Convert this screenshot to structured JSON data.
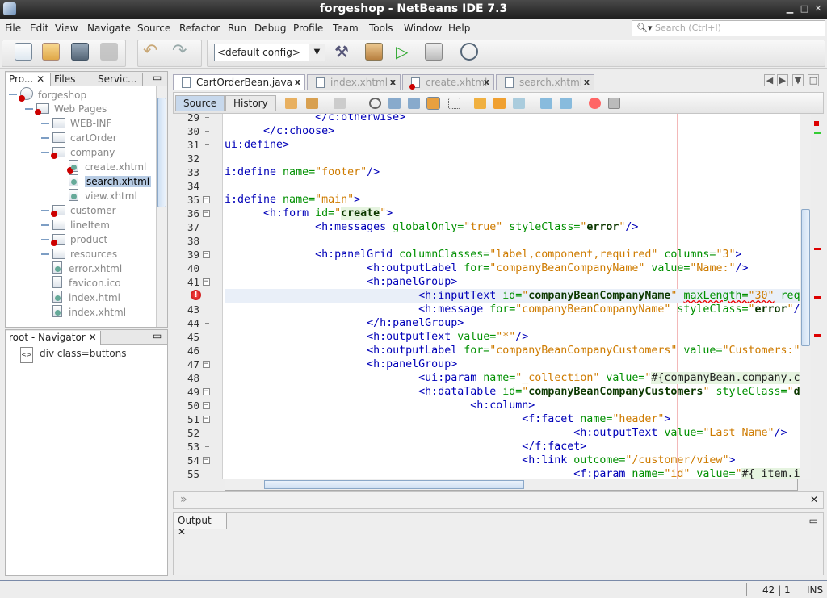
{
  "window": {
    "title": "forgeshop - NetBeans IDE 7.3"
  },
  "menu": [
    "File",
    "Edit",
    "View",
    "Navigate",
    "Source",
    "Refactor",
    "Run",
    "Debug",
    "Profile",
    "Team",
    "Tools",
    "Window",
    "Help"
  ],
  "search": {
    "placeholder": "Search (Ctrl+I)"
  },
  "toolbar": {
    "config": "<default config>",
    "icons": [
      "new-file",
      "new-project",
      "open-project",
      "save-all",
      "undo",
      "redo",
      "build",
      "clean-build",
      "run",
      "debug",
      "profile"
    ]
  },
  "left_panel": {
    "tabs": [
      "Pro...",
      "Files",
      "Servic..."
    ],
    "tree": [
      {
        "label": "forgeshop",
        "level": 0,
        "type": "project",
        "error": true
      },
      {
        "label": "Web Pages",
        "level": 1,
        "type": "folder",
        "error": true
      },
      {
        "label": "WEB-INF",
        "level": 2,
        "type": "folder"
      },
      {
        "label": "cartOrder",
        "level": 2,
        "type": "folder"
      },
      {
        "label": "company",
        "level": 2,
        "type": "folder",
        "error": true
      },
      {
        "label": "create.xhtml",
        "level": 3,
        "type": "file",
        "error": true
      },
      {
        "label": "search.xhtml",
        "level": 3,
        "type": "file",
        "selected": true
      },
      {
        "label": "view.xhtml",
        "level": 3,
        "type": "file"
      },
      {
        "label": "customer",
        "level": 2,
        "type": "folder",
        "error": true
      },
      {
        "label": "lineItem",
        "level": 2,
        "type": "folder"
      },
      {
        "label": "product",
        "level": 2,
        "type": "folder",
        "error": true
      },
      {
        "label": "resources",
        "level": 2,
        "type": "folder"
      },
      {
        "label": "error.xhtml",
        "level": 2,
        "type": "file"
      },
      {
        "label": "favicon.ico",
        "level": 2,
        "type": "plainfile"
      },
      {
        "label": "index.html",
        "level": 2,
        "type": "file"
      },
      {
        "label": "index.xhtml",
        "level": 2,
        "type": "file"
      }
    ]
  },
  "navigator": {
    "title": "root - Navigator",
    "items": [
      "div class=buttons"
    ]
  },
  "editor": {
    "tabs": [
      {
        "label": "CartOrderBean.java",
        "active": true
      },
      {
        "label": "index.xhtml"
      },
      {
        "label": "create.xhtml",
        "error": true
      },
      {
        "label": "search.xhtml"
      }
    ],
    "source_label": "Source",
    "history_label": "History",
    "lines": [
      {
        "n": "29",
        "fold": "end",
        "ind": 14,
        "tk": [
          [
            "</c:otherwise>",
            "tag"
          ]
        ]
      },
      {
        "n": "30",
        "fold": "end",
        "ind": 6,
        "tk": [
          [
            "</c:choose>",
            "tag"
          ]
        ]
      },
      {
        "n": "31",
        "fold": "end",
        "ind": 0,
        "tk": [
          [
            "ui:define>",
            "tag"
          ]
        ]
      },
      {
        "n": "32",
        "ind": 0,
        "tk": []
      },
      {
        "n": "33",
        "ind": 0,
        "tk": [
          [
            "i:define",
            "tag"
          ],
          [
            " name=",
            "attr"
          ],
          [
            "\"footer\"",
            "val"
          ],
          [
            "/>",
            "tag"
          ]
        ]
      },
      {
        "n": "34",
        "ind": 0,
        "tk": []
      },
      {
        "n": "35",
        "fold": "open",
        "ind": 0,
        "tk": [
          [
            "i:define",
            "tag"
          ],
          [
            " name=",
            "attr"
          ],
          [
            "\"main\"",
            "val"
          ],
          [
            ">",
            "tag"
          ]
        ]
      },
      {
        "n": "36",
        "fold": "open",
        "ind": 6,
        "tk": [
          [
            "<h:form",
            "tag"
          ],
          [
            " id=",
            "attr"
          ],
          [
            "\"",
            "val"
          ],
          [
            "create",
            "valb hl"
          ],
          [
            "\"",
            "val"
          ],
          [
            ">",
            "tag"
          ]
        ]
      },
      {
        "n": "37",
        "ind": 14,
        "tk": [
          [
            "<h:messages",
            "tag"
          ],
          [
            " globalOnly=",
            "attr"
          ],
          [
            "\"true\"",
            "val"
          ],
          [
            " styleClass=",
            "attr"
          ],
          [
            "\"",
            "val"
          ],
          [
            "error",
            "valb"
          ],
          [
            "\"",
            "val"
          ],
          [
            "/>",
            "tag"
          ]
        ]
      },
      {
        "n": "38",
        "ind": 0,
        "tk": []
      },
      {
        "n": "39",
        "fold": "open",
        "ind": 14,
        "tk": [
          [
            "<h:panelGrid",
            "tag"
          ],
          [
            " columnClasses=",
            "attr"
          ],
          [
            "\"label,component,required\"",
            "val"
          ],
          [
            " columns=",
            "attr"
          ],
          [
            "\"3\"",
            "val"
          ],
          [
            ">",
            "tag"
          ]
        ]
      },
      {
        "n": "40",
        "ind": 22,
        "tk": [
          [
            "<h:outputLabel",
            "tag"
          ],
          [
            " for=",
            "attr"
          ],
          [
            "\"companyBeanCompanyName\"",
            "val"
          ],
          [
            " value=",
            "attr"
          ],
          [
            "\"Name:\"",
            "val"
          ],
          [
            "/>",
            "tag"
          ]
        ]
      },
      {
        "n": "41",
        "fold": "open",
        "ind": 22,
        "tk": [
          [
            "<h:panelGroup>",
            "tag"
          ]
        ]
      },
      {
        "n": "",
        "error": true,
        "current": true,
        "ind": 30,
        "tk": [
          [
            "<h:inputText",
            "tag"
          ],
          [
            " id=",
            "attr"
          ],
          [
            "\"",
            "val"
          ],
          [
            "companyBeanCompanyName",
            "valb"
          ],
          [
            "\"",
            "val"
          ],
          [
            " ",
            "attr"
          ],
          [
            "maxLength=",
            "attr wavy"
          ],
          [
            "\"30\"",
            "val wavy"
          ],
          [
            " req",
            "attr"
          ]
        ]
      },
      {
        "n": "43",
        "ind": 30,
        "tk": [
          [
            "<h:message",
            "tag"
          ],
          [
            " for=",
            "attr"
          ],
          [
            "\"companyBeanCompanyName\"",
            "val"
          ],
          [
            " styleClass=",
            "attr"
          ],
          [
            "\"",
            "val"
          ],
          [
            "error",
            "valb"
          ],
          [
            "\"",
            "val"
          ],
          [
            "/",
            "tag"
          ]
        ]
      },
      {
        "n": "44",
        "fold": "end",
        "ind": 22,
        "tk": [
          [
            "</h:panelGroup>",
            "tag"
          ]
        ]
      },
      {
        "n": "45",
        "ind": 22,
        "tk": [
          [
            "<h:outputText",
            "tag"
          ],
          [
            " value=",
            "attr"
          ],
          [
            "\"*\"",
            "val"
          ],
          [
            "/>",
            "tag"
          ]
        ]
      },
      {
        "n": "46",
        "ind": 22,
        "tk": [
          [
            "<h:outputLabel",
            "tag"
          ],
          [
            " for=",
            "attr"
          ],
          [
            "\"companyBeanCompanyCustomers\"",
            "val"
          ],
          [
            " value=",
            "attr"
          ],
          [
            "\"Customers:\"",
            "val"
          ]
        ]
      },
      {
        "n": "47",
        "fold": "open",
        "ind": 22,
        "tk": [
          [
            "<h:panelGroup>",
            "tag"
          ]
        ]
      },
      {
        "n": "48",
        "ind": 30,
        "tk": [
          [
            "<ui:param",
            "tag"
          ],
          [
            " name=",
            "attr"
          ],
          [
            "\"_collection\"",
            "val"
          ],
          [
            " value=",
            "attr"
          ],
          [
            "\"",
            "val"
          ],
          [
            "#{companyBean.company.c",
            "hl"
          ]
        ]
      },
      {
        "n": "49",
        "fold": "open",
        "ind": 30,
        "tk": [
          [
            "<h:dataTable",
            "tag"
          ],
          [
            " id=",
            "attr"
          ],
          [
            "\"",
            "val"
          ],
          [
            "companyBeanCompanyCustomers",
            "valb"
          ],
          [
            "\"",
            "val"
          ],
          [
            " styleClass=",
            "attr"
          ],
          [
            "\"",
            "val"
          ],
          [
            "d",
            "valb"
          ]
        ]
      },
      {
        "n": "50",
        "fold": "open",
        "ind": 38,
        "tk": [
          [
            "<h:column>",
            "tag"
          ]
        ]
      },
      {
        "n": "51",
        "fold": "open",
        "ind": 46,
        "tk": [
          [
            "<f:facet",
            "tag"
          ],
          [
            " name=",
            "attr"
          ],
          [
            "\"header\"",
            "val"
          ],
          [
            ">",
            "tag"
          ]
        ]
      },
      {
        "n": "52",
        "ind": 54,
        "tk": [
          [
            "<h:outputText",
            "tag"
          ],
          [
            " value=",
            "attr"
          ],
          [
            "\"Last Name\"",
            "val"
          ],
          [
            "/>",
            "tag"
          ]
        ]
      },
      {
        "n": "53",
        "fold": "end",
        "ind": 46,
        "tk": [
          [
            "</f:facet>",
            "tag"
          ]
        ]
      },
      {
        "n": "54",
        "fold": "open",
        "ind": 46,
        "tk": [
          [
            "<h:link",
            "tag"
          ],
          [
            " outcome=",
            "attr"
          ],
          [
            "\"/customer/view\"",
            "val"
          ],
          [
            ">",
            "tag"
          ]
        ]
      },
      {
        "n": "55",
        "ind": 54,
        "tk": [
          [
            "<f:param",
            "tag"
          ],
          [
            " name=",
            "attr"
          ],
          [
            "\"id\"",
            "val"
          ],
          [
            " value=",
            "attr"
          ],
          [
            "\"",
            "val"
          ],
          [
            "#{_item.i",
            "hl"
          ]
        ]
      }
    ]
  },
  "output": {
    "title": "Output"
  },
  "status": {
    "position": "42 | 1",
    "mode": "INS"
  },
  "colors": {
    "tag": "#0000b8",
    "attr": "#009000",
    "value": "#ce7b00",
    "error": "#d00000",
    "selection": "#b8cce4"
  }
}
